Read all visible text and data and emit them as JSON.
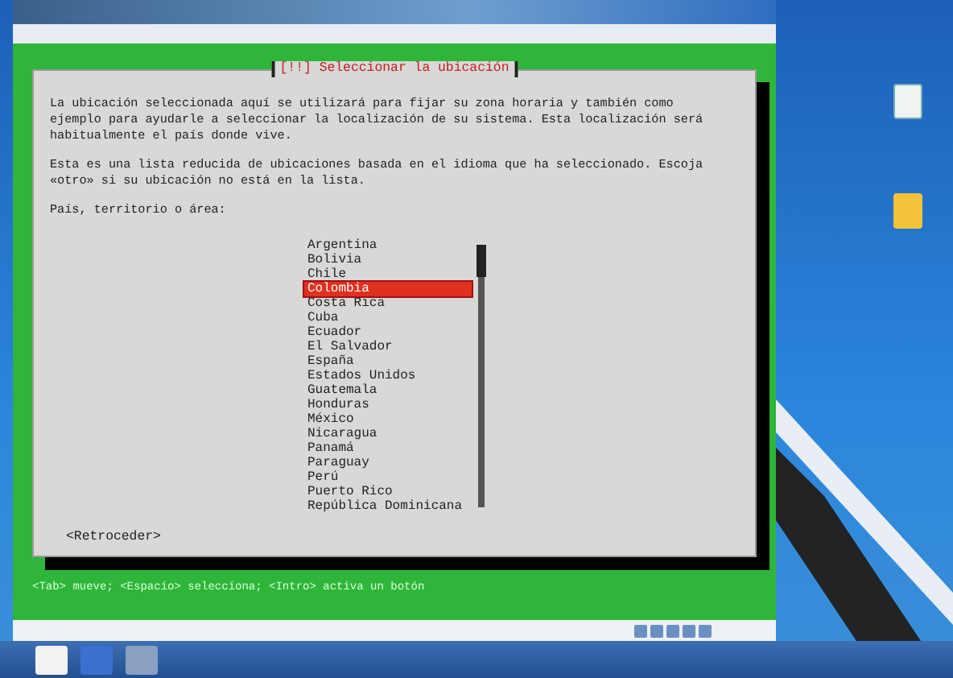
{
  "dialog": {
    "title": "[!!] Seleccionar la ubicación",
    "paragraphs": [
      "La ubicación seleccionada aquí se utilizará para fijar su zona horaria y también como\nejemplo para ayudarle a seleccionar la localización de su sistema. Esta localización será\nhabitualmente el país donde vive.",
      "Esta es una lista reducida de ubicaciones basada en el idioma que ha seleccionado. Escoja\n«otro» si su ubicación no está en la lista."
    ],
    "prompt": "País, territorio o área:",
    "options": [
      {
        "label": "Argentina",
        "selected": false
      },
      {
        "label": "Bolivia",
        "selected": false
      },
      {
        "label": "Chile",
        "selected": false
      },
      {
        "label": "Colombia",
        "selected": true
      },
      {
        "label": "Costa Rica",
        "selected": false
      },
      {
        "label": "Cuba",
        "selected": false
      },
      {
        "label": "Ecuador",
        "selected": false
      },
      {
        "label": "El Salvador",
        "selected": false
      },
      {
        "label": "España",
        "selected": false
      },
      {
        "label": "Estados Unidos",
        "selected": false
      },
      {
        "label": "Guatemala",
        "selected": false
      },
      {
        "label": "Honduras",
        "selected": false
      },
      {
        "label": "México",
        "selected": false
      },
      {
        "label": "Nicaragua",
        "selected": false
      },
      {
        "label": "Panamá",
        "selected": false
      },
      {
        "label": "Paraguay",
        "selected": false
      },
      {
        "label": "Perú",
        "selected": false
      },
      {
        "label": "Puerto Rico",
        "selected": false
      },
      {
        "label": "República Dominicana",
        "selected": false
      }
    ],
    "back_button": "<Retroceder>"
  },
  "help_line": "<Tab> mueve; <Espacio> selecciona; <Intro> activa un botón"
}
